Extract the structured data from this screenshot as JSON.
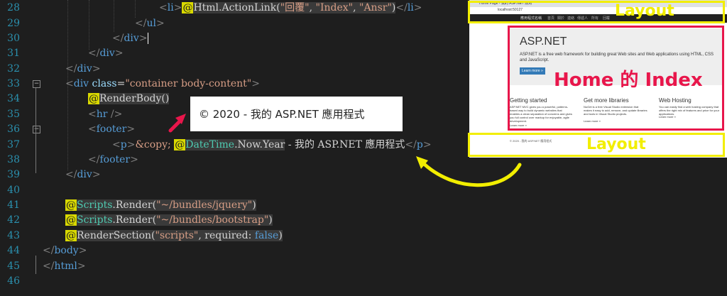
{
  "editor": {
    "line_numbers": [
      "28",
      "29",
      "30",
      "31",
      "32",
      "33",
      "34",
      "35",
      "36",
      "37",
      "38",
      "39",
      "40",
      "41",
      "42",
      "43",
      "44",
      "45",
      "46"
    ],
    "lines": {
      "l28": {
        "helper": "Html",
        "mid": ".ActionLink(",
        "s1": "\"回覆\"",
        "s2": "\"Index\"",
        "s3": "\"Ansr\"",
        "end": ")"
      },
      "l37_text": " - 我的 ASP.NET 應用程式",
      "l34": "RenderBody()",
      "l37_cls": "DateTime",
      "l37_prop": ".Now.Year",
      "l41_arg": "\"~/bundles/jquery\"",
      "l42_arg": "\"~/bundles/bootstrap\"",
      "l43_arg": "\"scripts\"",
      "l43_kw": "false",
      "scripts": "Scripts",
      "render": ".Render(",
      "rendersection": "RenderSection(",
      "required": ", required: ",
      "container_class": "\"container body-content\""
    }
  },
  "callout": {
    "text": "© 2020 - 我的 ASP.NET 應用程式"
  },
  "preview": {
    "tab_title": "Home Page - 我的 ASP.NET 應用",
    "address": "localhost:50127",
    "nav": [
      "應用程式名稱",
      "首頁",
      "關於",
      "連絡",
      "傳遞人",
      "所有",
      "回覆"
    ],
    "jumbotron_title": "ASP.NET",
    "jumbotron_text": "ASP.NET is a free web framework for building great Web sites and Web applications using HTML, CSS and JavaScript.",
    "learn_more": "Learn more »",
    "col1_title": "Getting started",
    "col1_text": "ASP.NET MVC gives you a powerful, patterns-based way to build dynamic websites that enables a clean separation of concerns and gives you full control over markup for enjoyable, agile development.",
    "col2_title": "Get more libraries",
    "col2_text": "NuGet is a free Visual Studio extension that makes it easy to add, remove, and update libraries and tools in Visual Studio projects.",
    "col3_title": "Web Hosting",
    "col3_text": "You can easily find a web hosting company that offers the right mix of features and price for your applications.",
    "footer": "© 2020 - 我的 ASP.NET 應用程式"
  },
  "overlays": {
    "top_label": "Layout",
    "home_label": "Home 的 Index",
    "bottom_label": "Layout",
    "colors": {
      "layout": "#f2ee00",
      "home": "#e8164b",
      "arrow_red": "#e8164b",
      "arrow_yellow": "#f2ee00"
    }
  }
}
